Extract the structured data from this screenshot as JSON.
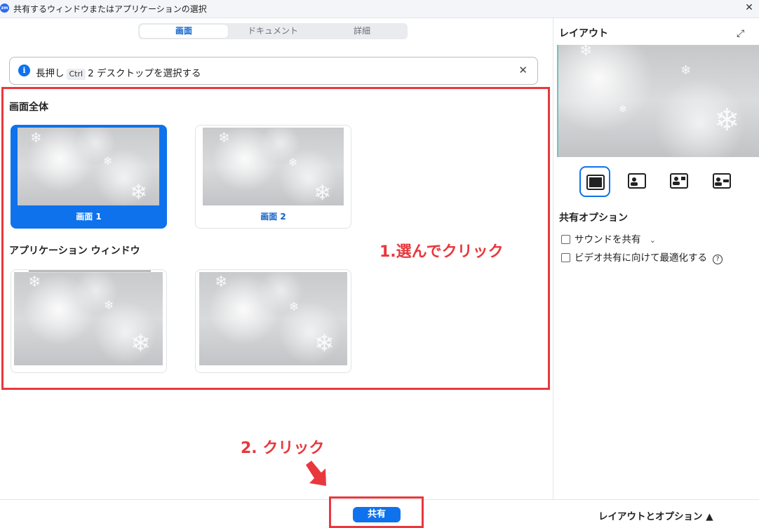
{
  "window": {
    "title": "共有するウィンドウまたはアプリケーションの選択",
    "app_icon": "zm",
    "close": "✕"
  },
  "tabs": [
    {
      "label": "画面",
      "active": true
    },
    {
      "label": "ドキュメント",
      "active": false
    },
    {
      "label": "詳細",
      "active": false
    }
  ],
  "info": {
    "icon": "i",
    "before": "長押し",
    "key": "Ctrl",
    "after": "2 デスクトップを選択する",
    "close": "✕"
  },
  "sections": {
    "screens_title": "画面全体",
    "apps_title": "アプリケーション ウィンドウ"
  },
  "screens": [
    {
      "label": "画面 1",
      "selected": true
    },
    {
      "label": "画面 2",
      "selected": false
    }
  ],
  "annotations": {
    "step1": "1.選んでクリック",
    "step2": "2. クリック"
  },
  "right_panel": {
    "layout_title": "レイアウト",
    "options_title": "共有オプション",
    "sound_option": "サウンドを共有",
    "sound_chevron": "⌄",
    "video_option": "ビデオ共有に向けて最適化する",
    "help": "?",
    "expand": "⤢"
  },
  "footer": {
    "share_label": "共有",
    "layout_options_label": "レイアウトとオプション ▲"
  },
  "colors": {
    "accent": "#0e72ed",
    "annotation_red": "#e8383d"
  }
}
